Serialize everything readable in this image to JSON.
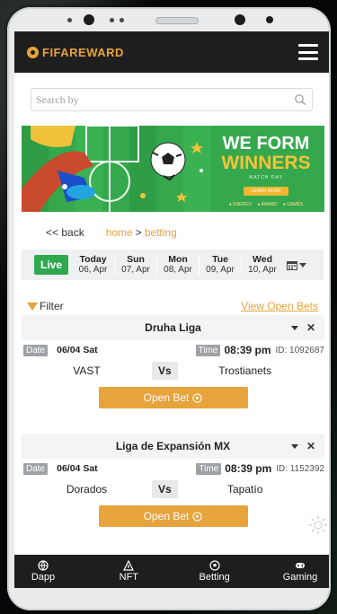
{
  "brand": {
    "name": "FIFAREWARD"
  },
  "search": {
    "placeholder": "Search by"
  },
  "banner": {
    "headline1": "WE FORM",
    "headline2": "WINNERS",
    "subline": "MATCH DAY",
    "button": "LEARN MORE",
    "dots": [
      "● ENERGY",
      "● AWARD",
      "● GAMES"
    ]
  },
  "breadcrumb": {
    "back": "<< back",
    "home": "home",
    "separator": ">",
    "current": "betting"
  },
  "date_bar": {
    "live_label": "Live",
    "days": [
      {
        "name": "Today",
        "date": "06, Apr"
      },
      {
        "name": "Sun",
        "date": "07, Apr"
      },
      {
        "name": "Mon",
        "date": "08, Apr"
      },
      {
        "name": "Tue",
        "date": "09, Apr"
      },
      {
        "name": "Wed",
        "date": "10, Apr"
      }
    ]
  },
  "filter": {
    "label": "Filter",
    "view_open": "View Open Bets"
  },
  "labels": {
    "date": "Date",
    "time": "Time",
    "vs": "Vs",
    "open_bet": "Open Bet",
    "close": "✕"
  },
  "matches": [
    {
      "league": "Druha Liga",
      "date": "06/04 Sat",
      "time": "08:39 pm",
      "id": "ID: 1092687",
      "home": "VAST",
      "away": "Trostianets"
    },
    {
      "league": "Liga de Expansión MX",
      "date": "06/04 Sat",
      "time": "08:39 pm",
      "id": "ID: 1152392",
      "home": "Dorados",
      "away": "Tapatío"
    }
  ],
  "nav": [
    {
      "label": "Dapp"
    },
    {
      "label": "NFT"
    },
    {
      "label": "Betting"
    },
    {
      "label": "Gaming"
    }
  ],
  "colors": {
    "accent": "#e7a33c",
    "live": "#2fa84f",
    "dark": "#1e1e1e",
    "banner_green": "#39b04f"
  }
}
